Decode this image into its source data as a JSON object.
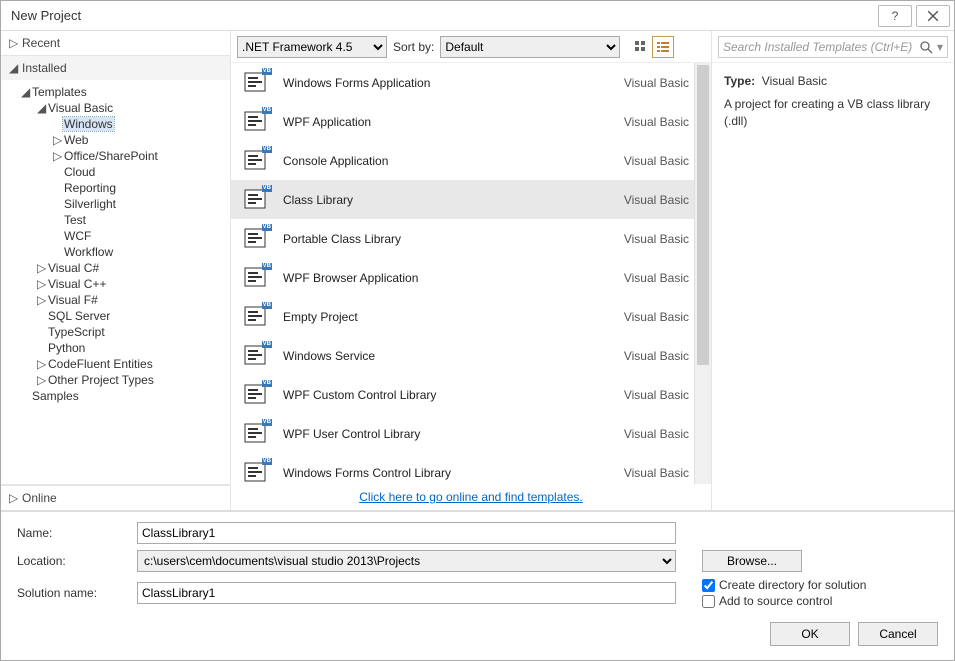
{
  "window": {
    "title": "New Project"
  },
  "left": {
    "recent": "Recent",
    "installed": "Installed",
    "online": "Online",
    "templates_label": "Templates",
    "samples_label": "Samples",
    "tree": {
      "vb": "Visual Basic",
      "windows": "Windows",
      "web": "Web",
      "office": "Office/SharePoint",
      "cloud": "Cloud",
      "reporting": "Reporting",
      "silverlight": "Silverlight",
      "test": "Test",
      "wcf": "WCF",
      "workflow": "Workflow",
      "csharp": "Visual C#",
      "cpp": "Visual C++",
      "fsharp": "Visual F#",
      "sql": "SQL Server",
      "ts": "TypeScript",
      "python": "Python",
      "codefluent": "CodeFluent Entities",
      "other": "Other Project Types"
    }
  },
  "toolbar": {
    "framework": ".NET Framework 4.5",
    "sort_label": "Sort by:",
    "sort_value": "Default"
  },
  "templates": [
    {
      "name": "Windows Forms Application",
      "lang": "Visual Basic"
    },
    {
      "name": "WPF Application",
      "lang": "Visual Basic"
    },
    {
      "name": "Console Application",
      "lang": "Visual Basic"
    },
    {
      "name": "Class Library",
      "lang": "Visual Basic",
      "selected": true
    },
    {
      "name": "Portable Class Library",
      "lang": "Visual Basic"
    },
    {
      "name": "WPF Browser Application",
      "lang": "Visual Basic"
    },
    {
      "name": "Empty Project",
      "lang": "Visual Basic"
    },
    {
      "name": "Windows Service",
      "lang": "Visual Basic"
    },
    {
      "name": "WPF Custom Control Library",
      "lang": "Visual Basic"
    },
    {
      "name": "WPF User Control Library",
      "lang": "Visual Basic"
    },
    {
      "name": "Windows Forms Control Library",
      "lang": "Visual Basic"
    }
  ],
  "mid_footer_link": "Click here to go online and find templates.",
  "right": {
    "search_placeholder": "Search Installed Templates (Ctrl+E)",
    "type_label": "Type:",
    "type_value": "Visual Basic",
    "description": "A project for creating a VB class library (.dll)"
  },
  "form": {
    "name_label": "Name:",
    "name_value": "ClassLibrary1",
    "location_label": "Location:",
    "location_value": "c:\\users\\cem\\documents\\visual studio 2013\\Projects",
    "browse": "Browse...",
    "solution_label": "Solution name:",
    "solution_value": "ClassLibrary1",
    "chk_createdir": "Create directory for solution",
    "chk_source": "Add to source control",
    "ok": "OK",
    "cancel": "Cancel"
  },
  "icon_badge": "VB"
}
